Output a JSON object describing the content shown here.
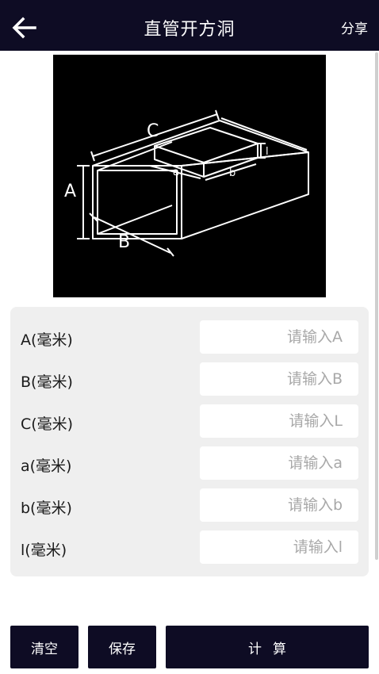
{
  "header": {
    "title": "直管开方洞",
    "share_label": "分享",
    "back_icon": "arrow-left-icon"
  },
  "diagram": {
    "labels": {
      "A": "A",
      "B": "B",
      "C": "C",
      "a": "a",
      "b": "b",
      "l": "l"
    }
  },
  "form": {
    "fields": [
      {
        "label": "A(毫米)",
        "placeholder": "请输入A",
        "value": ""
      },
      {
        "label": "B(毫米)",
        "placeholder": "请输入B",
        "value": ""
      },
      {
        "label": "C(毫米)",
        "placeholder": "请输入L",
        "value": ""
      },
      {
        "label": "a(毫米)",
        "placeholder": "请输入a",
        "value": ""
      },
      {
        "label": "b(毫米)",
        "placeholder": "请输入b",
        "value": ""
      },
      {
        "label": "l(毫米)",
        "placeholder": "请输入l",
        "value": ""
      }
    ]
  },
  "buttons": {
    "clear_label": "清空",
    "save_label": "保存",
    "calc_label": "计算"
  },
  "colors": {
    "header_bg": "#0e0c24",
    "form_bg": "#efefef",
    "button_bg": "#0e0c24"
  }
}
